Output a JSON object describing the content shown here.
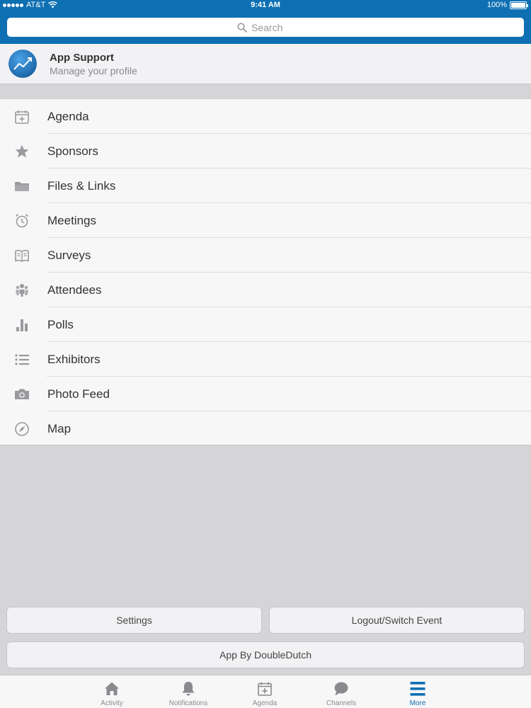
{
  "status": {
    "carrier": "AT&T",
    "time": "9:41 AM",
    "battery": "100%",
    "battery_level": 1.0
  },
  "search": {
    "placeholder": "Search"
  },
  "profile": {
    "name": "App Support",
    "subtitle": "Manage your profile"
  },
  "menu": {
    "items": [
      {
        "label": "Agenda",
        "icon": "calendar-plus-icon"
      },
      {
        "label": "Sponsors",
        "icon": "star-icon"
      },
      {
        "label": "Files & Links",
        "icon": "folder-icon"
      },
      {
        "label": "Meetings",
        "icon": "alarm-clock-icon"
      },
      {
        "label": "Surveys",
        "icon": "open-book-icon"
      },
      {
        "label": "Attendees",
        "icon": "people-icon"
      },
      {
        "label": "Polls",
        "icon": "bar-chart-icon"
      },
      {
        "label": "Exhibitors",
        "icon": "list-icon"
      },
      {
        "label": "Photo Feed",
        "icon": "camera-icon"
      },
      {
        "label": "Map",
        "icon": "compass-icon"
      }
    ]
  },
  "buttons": {
    "settings": "Settings",
    "logout": "Logout/Switch Event",
    "credits": "App By DoubleDutch"
  },
  "tabs": [
    {
      "label": "Activity",
      "icon": "home-icon"
    },
    {
      "label": "Notifications",
      "icon": "bell-icon"
    },
    {
      "label": "Agenda",
      "icon": "calendar-plus-icon"
    },
    {
      "label": "Channels",
      "icon": "chat-bubble-icon"
    },
    {
      "label": "More",
      "icon": "hamburger-menu-icon",
      "active": true
    }
  ],
  "colors": {
    "brand": "#0e6fb3",
    "icon_gray": "#9a9a9e",
    "text": "#333333"
  }
}
